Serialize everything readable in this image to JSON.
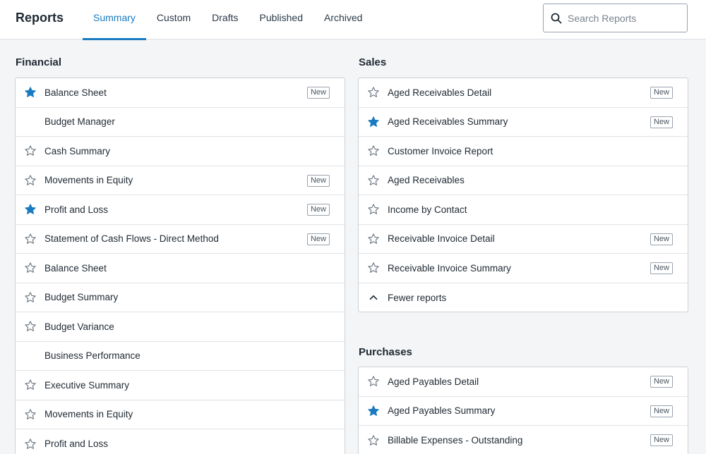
{
  "header": {
    "title": "Reports",
    "tabs": [
      {
        "label": "Summary",
        "active": true
      },
      {
        "label": "Custom",
        "active": false
      },
      {
        "label": "Drafts",
        "active": false
      },
      {
        "label": "Published",
        "active": false
      },
      {
        "label": "Archived",
        "active": false
      }
    ],
    "search": {
      "placeholder": "Search Reports",
      "icon": "search-icon"
    }
  },
  "colors": {
    "accent": "#1a7bc0",
    "star_filled": "#1a7bc0",
    "star_outline": "#6b7580"
  },
  "financial": {
    "title": "Financial",
    "items": [
      {
        "label": "Balance Sheet",
        "star": "filled",
        "badge": "New"
      },
      {
        "label": "Budget Manager",
        "star": "none",
        "badge": ""
      },
      {
        "label": "Cash Summary",
        "star": "outline",
        "badge": ""
      },
      {
        "label": "Movements in Equity",
        "star": "outline",
        "badge": "New"
      },
      {
        "label": "Profit and Loss",
        "star": "filled",
        "badge": "New"
      },
      {
        "label": "Statement of Cash Flows - Direct Method",
        "star": "outline",
        "badge": "New"
      },
      {
        "label": "Balance Sheet",
        "star": "outline",
        "badge": ""
      },
      {
        "label": "Budget Summary",
        "star": "outline",
        "badge": ""
      },
      {
        "label": "Budget Variance",
        "star": "outline",
        "badge": ""
      },
      {
        "label": "Business Performance",
        "star": "none",
        "badge": ""
      },
      {
        "label": "Executive Summary",
        "star": "outline",
        "badge": ""
      },
      {
        "label": "Movements in Equity",
        "star": "outline",
        "badge": ""
      },
      {
        "label": "Profit and Loss",
        "star": "outline",
        "badge": ""
      }
    ]
  },
  "sales": {
    "title": "Sales",
    "items": [
      {
        "label": "Aged Receivables Detail",
        "star": "outline",
        "badge": "New"
      },
      {
        "label": "Aged Receivables Summary",
        "star": "filled",
        "badge": "New"
      },
      {
        "label": "Customer Invoice Report",
        "star": "outline",
        "badge": ""
      },
      {
        "label": "Aged Receivables",
        "star": "outline",
        "badge": ""
      },
      {
        "label": "Income by Contact",
        "star": "outline",
        "badge": ""
      },
      {
        "label": "Receivable Invoice Detail",
        "star": "outline",
        "badge": "New"
      },
      {
        "label": "Receivable Invoice Summary",
        "star": "outline",
        "badge": "New"
      },
      {
        "label": "Fewer reports",
        "star": "chevron-up",
        "badge": ""
      }
    ]
  },
  "purchases": {
    "title": "Purchases",
    "items": [
      {
        "label": "Aged Payables Detail",
        "star": "outline",
        "badge": "New"
      },
      {
        "label": "Aged Payables Summary",
        "star": "filled",
        "badge": "New"
      },
      {
        "label": "Billable Expenses - Outstanding",
        "star": "outline",
        "badge": "New"
      }
    ]
  }
}
